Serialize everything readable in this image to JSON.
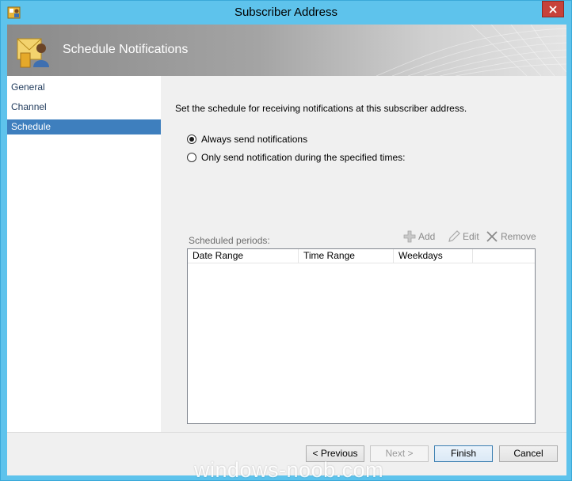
{
  "window": {
    "title": "Subscriber Address",
    "close_label": "Close"
  },
  "banner": {
    "title": "Schedule Notifications"
  },
  "nav": {
    "items": [
      {
        "label": "General"
      },
      {
        "label": "Channel"
      },
      {
        "label": "Schedule"
      }
    ],
    "selected": "Schedule"
  },
  "content": {
    "description": "Set the schedule for receiving notifications at this subscriber address.",
    "radio_always": {
      "label": "Always send notifications",
      "selected": true
    },
    "radio_only": {
      "label": "Only send notification during the specified times:",
      "selected": false
    },
    "periods_label": "Scheduled periods:",
    "toolbar": {
      "add": "Add",
      "edit": "Edit",
      "remove": "Remove"
    },
    "columns": [
      "Date Range",
      "Time Range",
      "Weekdays"
    ],
    "rows": []
  },
  "footer": {
    "previous": "< Previous",
    "next": "Next >",
    "finish": "Finish",
    "cancel": "Cancel"
  },
  "watermark": "windows-noob.com",
  "colors": {
    "frame": "#5ec3ec",
    "selection": "#3e7fbe",
    "close": "#c7423a"
  }
}
